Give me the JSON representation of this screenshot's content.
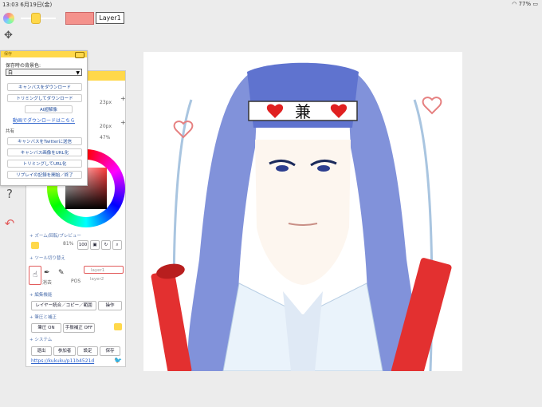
{
  "status_bar": {
    "time": "13:03",
    "date": "6月19日(金)",
    "battery": "77%"
  },
  "toolbar": {
    "layer_label": "Layer1"
  },
  "popup": {
    "title": "保存",
    "bg_label": "保存時の背景色:",
    "bg_value": "白",
    "buttons": [
      "キャンバスをダウンロード",
      "トリミングしてダウンロード",
      "AI超解像"
    ],
    "link": "動画でダウンロードはこちら",
    "section2": "共有",
    "share_buttons": [
      "キャンバスをTwitterに送信",
      "キャンバス画像をURL化",
      "トリミングしてURL化",
      "リプレイの記録を開始／終了"
    ]
  },
  "panel": {
    "size1": "23px",
    "size2": "20px",
    "opacity": "47%",
    "zoom_label": "ズーム/回転/プレビュー",
    "zoom_value": "81%",
    "zoom_100": "100",
    "tool_label": "ツール切り替え",
    "tools": [
      "消去",
      "POS"
    ],
    "layer_items": [
      "layer1",
      "layer2"
    ],
    "edit_label": "編集機能",
    "edit_buttons": [
      "レイヤー統合／コピー／範囲",
      "操作"
    ],
    "assist_label": "筆圧と補正",
    "assist_buttons": [
      "筆圧 ON",
      "手振補正 OFF"
    ],
    "system_label": "システム",
    "system_buttons": [
      "退出",
      "参加者",
      "設定",
      "保存"
    ],
    "url": "https://kukuku/p11b4521d"
  },
  "colors": {
    "accent": "#ffd84a",
    "swatch": "#f4928c",
    "link": "#3366cc"
  }
}
